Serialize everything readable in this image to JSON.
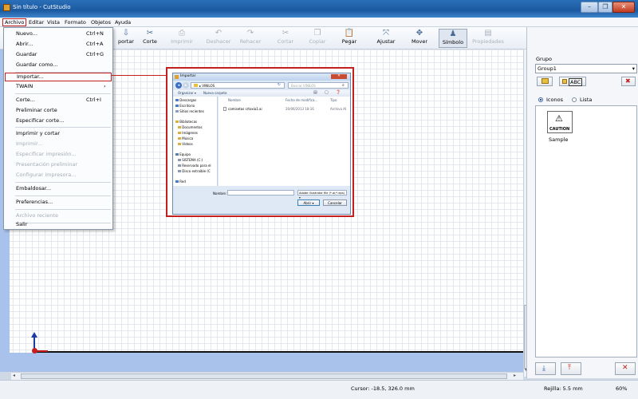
{
  "window": {
    "title": "Sin título - CutStudio"
  },
  "menu": [
    "Archivo",
    "Editar",
    "Vista",
    "Formato",
    "Objetos",
    "Ayuda"
  ],
  "toolbar": [
    {
      "label": "portar",
      "icon": "import-icon",
      "glyph": "⇩"
    },
    {
      "label": "Corte",
      "icon": "cut-plot-icon",
      "glyph": "✂"
    },
    {
      "label": "Imprimir",
      "icon": "print-icon",
      "glyph": "⎙"
    },
    {
      "label": "Deshacer",
      "icon": "undo-icon",
      "glyph": "↶"
    },
    {
      "label": "Rehacer",
      "icon": "redo-icon",
      "glyph": "↷"
    },
    {
      "label": "Cortar",
      "icon": "scissors-icon",
      "glyph": "✂"
    },
    {
      "label": "Copiar",
      "icon": "copy-icon",
      "glyph": "❐"
    },
    {
      "label": "Pegar",
      "icon": "paste-icon",
      "glyph": "📋"
    },
    {
      "label": "Ajustar",
      "icon": "fit-icon",
      "glyph": "⤧"
    },
    {
      "label": "Mover",
      "icon": "move-icon",
      "glyph": "✥"
    },
    {
      "label": "Símbolo",
      "icon": "symbol-icon",
      "glyph": "♟"
    },
    {
      "label": "Propiedades",
      "icon": "properties-icon",
      "glyph": "▤"
    }
  ],
  "file_menu": [
    {
      "label": "Nuevo...",
      "shortcut": "Ctrl+N"
    },
    {
      "label": "Abrir...",
      "shortcut": "Ctrl+A"
    },
    {
      "label": "Guardar",
      "shortcut": "Ctrl+G"
    },
    {
      "label": "Guardar como...",
      "shortcut": ""
    },
    {
      "label": "Importar...",
      "shortcut": ""
    },
    {
      "label": "TWAIN",
      "shortcut": "›"
    },
    {
      "label": "Corte...",
      "shortcut": "Ctrl+I"
    },
    {
      "label": "Preliminar corte",
      "shortcut": ""
    },
    {
      "label": "Especificar corte...",
      "shortcut": ""
    },
    {
      "label": "Imprimir y cortar",
      "shortcut": ""
    },
    {
      "label": "Imprimir...",
      "shortcut": ""
    },
    {
      "label": "Especificar impresión...",
      "shortcut": ""
    },
    {
      "label": "Presentación preliminar",
      "shortcut": ""
    },
    {
      "label": "Configurar impresora...",
      "shortcut": ""
    },
    {
      "label": "Embaldosar...",
      "shortcut": ""
    },
    {
      "label": "Preferencias...",
      "shortcut": ""
    },
    {
      "label": "Archivo reciente",
      "shortcut": ""
    },
    {
      "label": "Salir",
      "shortcut": ""
    }
  ],
  "import_dialog": {
    "title": "Importar",
    "path": "▸ VINILOS",
    "search_placeholder": "Buscar VINILOS",
    "organize": "Organizar ▾",
    "new_folder": "Nueva carpeta",
    "nav": [
      {
        "label": "Descargas",
        "icon": "downloads-icon"
      },
      {
        "label": "Escritorio",
        "icon": "desktop-icon"
      },
      {
        "label": "Sitios recientes",
        "icon": "recent-icon"
      },
      {
        "label": "Bibliotecas",
        "icon": "libraries-icon"
      },
      {
        "label": "Documentos",
        "icon": "documents-icon"
      },
      {
        "label": "Imágenes",
        "icon": "pictures-icon"
      },
      {
        "label": "Música",
        "icon": "music-icon"
      },
      {
        "label": "Vídeos",
        "icon": "videos-icon"
      },
      {
        "label": "Equipo",
        "icon": "computer-icon"
      },
      {
        "label": "SISTEMA (C:)",
        "icon": "drive-icon"
      },
      {
        "label": "Reservado para el",
        "icon": "drive-icon"
      },
      {
        "label": "Disco extraíble (C",
        "icon": "removable-drive-icon"
      },
      {
        "label": "Red",
        "icon": "network-icon"
      }
    ],
    "columns": [
      "Nombre",
      "Fecha de modifica...",
      "Tipo"
    ],
    "files": [
      {
        "name": "camisetas crtoxia1.ai",
        "date": "20/06/2013 18:16",
        "type": "Archivo AI"
      }
    ],
    "filename_label": "Nombre:",
    "filetype": "Adobe Illustrator file (*.ai;*.eps) ▾",
    "open": "Abrir",
    "cancel": "Cancelar"
  },
  "panel": {
    "group_label": "Grupo",
    "group_value": "Group1",
    "text_button": "ABC",
    "view_icons": "Iconos",
    "view_list": "Lista",
    "symbol_name": "Sample",
    "caution": "CAUTION"
  },
  "status": {
    "cursor": "Cursor: -18.5, 326.0 mm",
    "grid": "Rejilla: 5.5 mm",
    "zoom": "60%"
  }
}
